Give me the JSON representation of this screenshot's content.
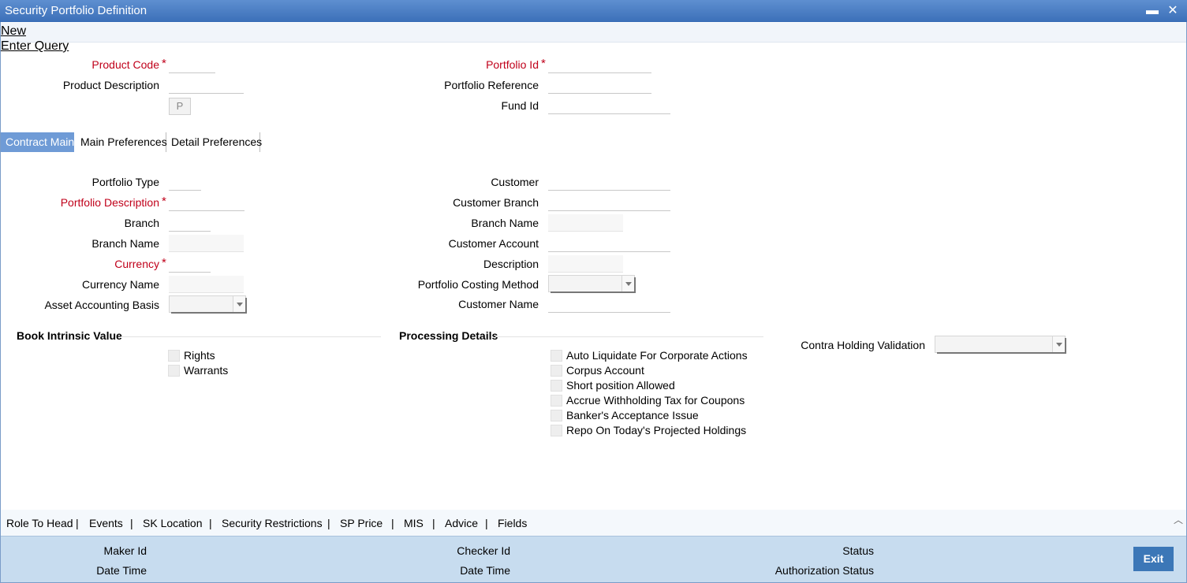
{
  "window": {
    "title": "Security Portfolio Definition",
    "minimize": "▬",
    "close": "✕"
  },
  "menu": {
    "new": "New",
    "enter_query": "Enter Query"
  },
  "header": {
    "product_code": "Product Code",
    "product_description": "Product Description",
    "p_button": "P",
    "portfolio_id": "Portfolio Id",
    "portfolio_reference": "Portfolio Reference",
    "fund_id": "Fund Id",
    "required_mark": "*"
  },
  "tabs": [
    "Contract Main",
    "Main Preferences",
    "Detail Preferences"
  ],
  "main": {
    "portfolio_type": "Portfolio Type",
    "portfolio_description": "Portfolio Description",
    "branch": "Branch",
    "branch_name": "Branch Name",
    "currency": "Currency",
    "currency_name": "Currency Name",
    "asset_accounting_basis": "Asset Accounting Basis",
    "customer": "Customer",
    "customer_branch": "Customer Branch",
    "customer_branch_name": "Branch Name",
    "customer_account": "Customer Account",
    "description": "Description",
    "portfolio_costing_method": "Portfolio Costing Method",
    "customer_name": "Customer Name"
  },
  "book_intrinsic": {
    "title": "Book Intrinsic Value",
    "rights": "Rights",
    "warrants": "Warrants"
  },
  "processing": {
    "title": "Processing Details",
    "items": [
      "Auto Liquidate For Corporate Actions",
      "Corpus Account",
      "Short position Allowed",
      "Accrue Withholding Tax for Coupons",
      "Banker's Acceptance Issue",
      "Repo On Today's Projected Holdings"
    ],
    "contra_holding_validation": "Contra Holding Validation"
  },
  "bottom_links": [
    "Role To Head",
    "Events",
    "SK Location",
    "Security Restrictions",
    "SP Price",
    "MIS",
    "Advice",
    "Fields"
  ],
  "bottom_sep": "|",
  "footer": {
    "maker_id": "Maker Id",
    "date_time_1": "Date Time",
    "checker_id": "Checker Id",
    "date_time_2": "Date Time",
    "status": "Status",
    "authorization_status": "Authorization Status",
    "exit": "Exit"
  }
}
